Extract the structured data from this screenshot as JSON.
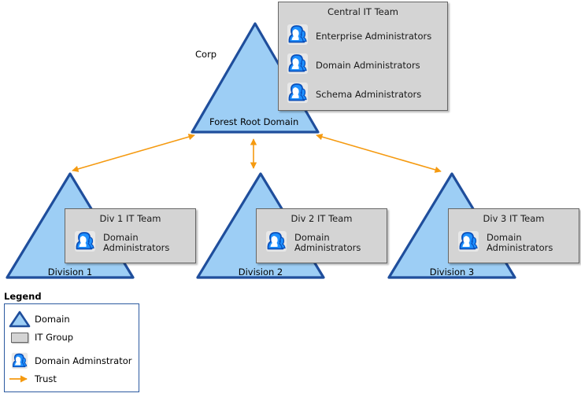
{
  "diagram": {
    "title_label": "Corp",
    "root_domain": {
      "label": "Forest Root Domain",
      "it_group": {
        "title": "Central IT Team",
        "members": [
          {
            "icon": "domain-administrator-icon",
            "label": "Enterprise Administrators"
          },
          {
            "icon": "domain-administrator-icon",
            "label": "Domain Administrators"
          },
          {
            "icon": "domain-administrator-icon",
            "label": "Schema Administrators"
          }
        ]
      }
    },
    "child_domains": [
      {
        "label": "Division 1",
        "it_group": {
          "title": "Div 1 IT Team",
          "members": [
            {
              "icon": "domain-administrator-icon",
              "label": "Domain\nAdministrators"
            }
          ]
        }
      },
      {
        "label": "Division 2",
        "it_group": {
          "title": "Div 2 IT Team",
          "members": [
            {
              "icon": "domain-administrator-icon",
              "label": "Domain\nAdministrators"
            }
          ]
        }
      },
      {
        "label": "Division 3",
        "it_group": {
          "title": "Div 3 IT Team",
          "members": [
            {
              "icon": "domain-administrator-icon",
              "label": "Domain\nAdministrators"
            }
          ]
        }
      }
    ],
    "trusts": [
      {
        "from": "Forest Root Domain",
        "to": "Division 1",
        "type": "two-way"
      },
      {
        "from": "Forest Root Domain",
        "to": "Division 2",
        "type": "two-way"
      },
      {
        "from": "Forest Root Domain",
        "to": "Division 3",
        "type": "two-way"
      }
    ]
  },
  "legend": {
    "title": "Legend",
    "items": [
      {
        "icon": "domain-triangle-icon",
        "label": "Domain"
      },
      {
        "icon": "it-group-box-icon",
        "label": "IT Group"
      },
      {
        "icon": "domain-administrator-icon",
        "label": "Domain Adminstrator"
      },
      {
        "icon": "trust-arrow-icon",
        "label": "Trust"
      }
    ]
  },
  "colors": {
    "domain_fill": "#9dcef5",
    "domain_stroke": "#1f4e9c",
    "itgroup_fill": "#d4d4d4",
    "itgroup_stroke": "#666666",
    "trust_arrow": "#f59a10",
    "legend_border": "#2c5aa0",
    "icon_blue": "#1e90ff",
    "icon_outline": "#0a4fba",
    "text": "#000000",
    "background": "#ffffff"
  }
}
